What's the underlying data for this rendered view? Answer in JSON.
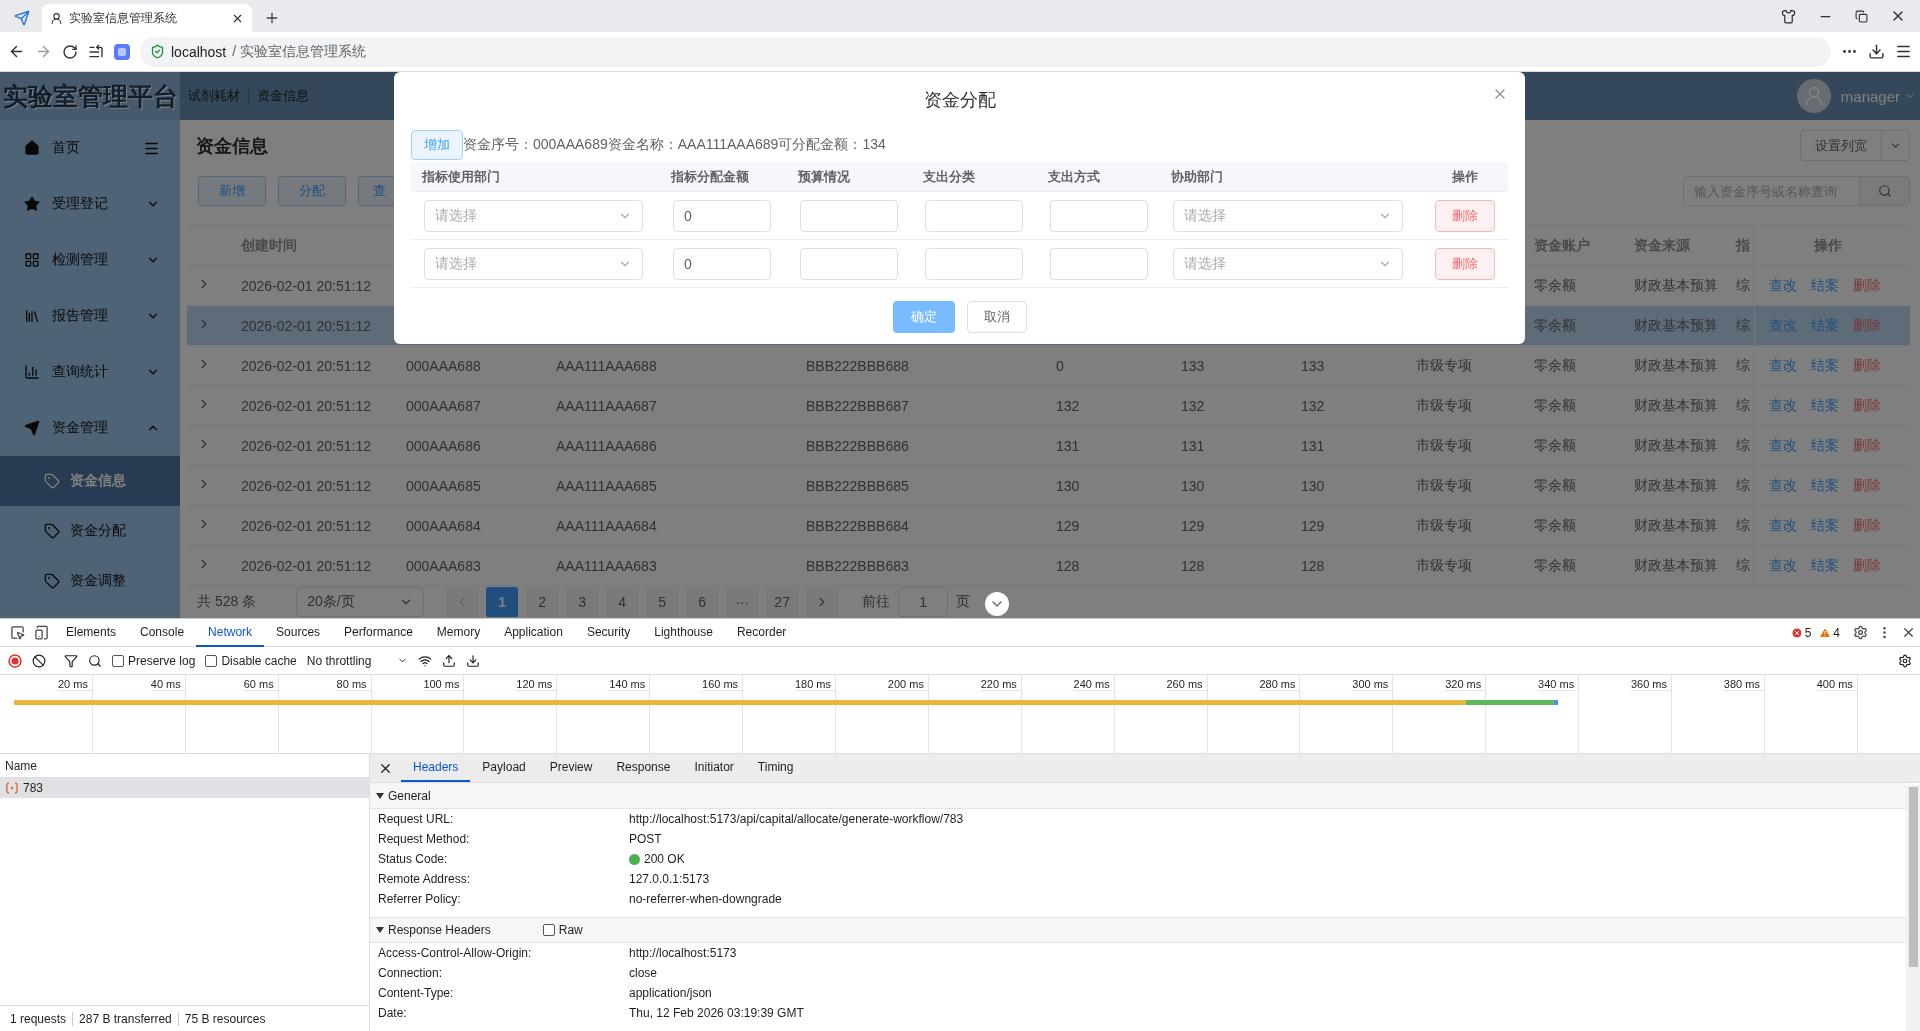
{
  "browser": {
    "tab_title": "实验室信息管理系统",
    "host": "localhost",
    "path": "/ 实验室信息管理系统"
  },
  "app": {
    "logo": "实验室管理平台",
    "breadcrumb": [
      "试剂耗材",
      "资金信息"
    ],
    "user": "manager"
  },
  "sidebar": {
    "items": [
      {
        "label": "首页"
      },
      {
        "label": "受理登记",
        "expanded": false
      },
      {
        "label": "检测管理",
        "expanded": false
      },
      {
        "label": "报告管理",
        "expanded": false
      },
      {
        "label": "查询统计",
        "expanded": false
      },
      {
        "label": "资金管理",
        "expanded": true,
        "children": [
          {
            "label": "资金信息",
            "selected": true
          },
          {
            "label": "资金分配",
            "selected": false
          },
          {
            "label": "资金调整",
            "selected": false
          }
        ]
      }
    ]
  },
  "page": {
    "title": "资金信息",
    "buttons": [
      "新增",
      "分配",
      "查"
    ],
    "settings_button": "设置列宽",
    "search": {
      "placeholder": "输入资金序号或名称查询"
    }
  },
  "table": {
    "header": {
      "created_at": "创建时间",
      "account": "资金账户",
      "source": "资金来源",
      "column_11": "指",
      "actions": "操作"
    },
    "rows": [
      {
        "selected": false,
        "created_at": "2026-02-01 20:51:12",
        "account": "零余额",
        "source": "财政基本预算",
        "column_11": "综",
        "actions": [
          "查改",
          "结案",
          "删除"
        ]
      },
      {
        "selected": true,
        "created_at": "2026-02-01 20:51:12",
        "account": "零余额",
        "source": "财政基本预算",
        "column_11": "综",
        "actions": [
          "查改",
          "结案",
          "删除"
        ]
      },
      {
        "selected": false,
        "created_at": "2026-02-01 20:51:12",
        "code": "000AAA688",
        "name": "AAA111AAA688",
        "budget_code": "BBB222BBB688",
        "column_5": "0",
        "column_6": "133",
        "column_7": "133",
        "category": "市级专项",
        "account": "零余额",
        "source": "财政基本预算",
        "column_11": "综",
        "actions": [
          "查改",
          "结案",
          "删除"
        ]
      },
      {
        "selected": false,
        "created_at": "2026-02-01 20:51:12",
        "code": "000AAA687",
        "name": "AAA111AAA687",
        "budget_code": "BBB222BBB687",
        "column_5": "132",
        "column_6": "132",
        "column_7": "132",
        "category": "市级专项",
        "account": "零余额",
        "source": "财政基本预算",
        "column_11": "综",
        "actions": [
          "查改",
          "结案",
          "删除"
        ]
      },
      {
        "selected": false,
        "created_at": "2026-02-01 20:51:12",
        "code": "000AAA686",
        "name": "AAA111AAA686",
        "budget_code": "BBB222BBB686",
        "column_5": "131",
        "column_6": "131",
        "column_7": "131",
        "category": "市级专项",
        "account": "零余额",
        "source": "财政基本预算",
        "column_11": "综",
        "actions": [
          "查改",
          "结案",
          "删除"
        ]
      },
      {
        "selected": false,
        "created_at": "2026-02-01 20:51:12",
        "code": "000AAA685",
        "name": "AAA111AAA685",
        "budget_code": "BBB222BBB685",
        "column_5": "130",
        "column_6": "130",
        "column_7": "130",
        "category": "市级专项",
        "account": "零余额",
        "source": "财政基本预算",
        "column_11": "综",
        "actions": [
          "查改",
          "结案",
          "删除"
        ]
      },
      {
        "selected": false,
        "created_at": "2026-02-01 20:51:12",
        "code": "000AAA684",
        "name": "AAA111AAA684",
        "budget_code": "BBB222BBB684",
        "column_5": "129",
        "column_6": "129",
        "column_7": "129",
        "category": "市级专项",
        "account": "零余额",
        "source": "财政基本预算",
        "column_11": "综",
        "actions": [
          "查改",
          "结案",
          "删除"
        ]
      },
      {
        "selected": false,
        "created_at": "2026-02-01 20:51:12",
        "code": "000AAA683",
        "name": "AAA111AAA683",
        "budget_code": "BBB222BBB683",
        "column_5": "128",
        "column_6": "128",
        "column_7": "128",
        "category": "市级专项",
        "account": "零余额",
        "source": "财政基本预算",
        "column_11": "综",
        "actions": [
          "查改",
          "结案",
          "删除"
        ]
      }
    ]
  },
  "pagination": {
    "total": "共 528 条",
    "page_size": "20条/页",
    "pages": [
      {
        "label": "1",
        "selected": true
      },
      {
        "label": "2",
        "selected": false
      },
      {
        "label": "3",
        "selected": false
      },
      {
        "label": "4",
        "selected": false
      },
      {
        "label": "5",
        "selected": false
      },
      {
        "label": "6",
        "selected": false
      },
      {
        "label": "···",
        "selected": false
      },
      {
        "label": "27",
        "selected": false
      }
    ],
    "goto_label": "前往",
    "goto_value": "1",
    "goto_unit": "页"
  },
  "dialog": {
    "title": "资金分配",
    "add_button": "增加",
    "info": "资金序号：000AAA689资金名称：AAA111AAA689可分配金额：134",
    "columns": [
      "指标使用部门",
      "指标分配金额",
      "预算情况",
      "支出分类",
      "支出方式",
      "协助部门",
      "操作"
    ],
    "rows": [
      {
        "department": {
          "placeholder": "请选择"
        },
        "amount": "0",
        "assist": {
          "placeholder": "请选择"
        },
        "delete_button": "删除"
      },
      {
        "department": {
          "placeholder": "请选择"
        },
        "amount": "0",
        "assist": {
          "placeholder": "请选择"
        },
        "delete_button": "删除"
      }
    ],
    "confirm_button": "确定",
    "cancel_button": "取消"
  },
  "devtools": {
    "tabs": [
      {
        "label": "Elements",
        "selected": false
      },
      {
        "label": "Console",
        "selected": false
      },
      {
        "label": "Network",
        "selected": true
      },
      {
        "label": "Sources",
        "selected": false
      },
      {
        "label": "Performance",
        "selected": false
      },
      {
        "label": "Memory",
        "selected": false
      },
      {
        "label": "Application",
        "selected": false
      },
      {
        "label": "Security",
        "selected": false
      },
      {
        "label": "Lighthouse",
        "selected": false
      },
      {
        "label": "Recorder",
        "selected": false
      }
    ],
    "errors": "5",
    "warnings": "4",
    "preserve_log": {
      "label": "Preserve log",
      "checked": false
    },
    "disable_cache": {
      "label": "Disable cache",
      "checked": false
    },
    "throttling": "No throttling",
    "ticks": [
      "20 ms",
      "40 ms",
      "60 ms",
      "80 ms",
      "100 ms",
      "120 ms",
      "140 ms",
      "160 ms",
      "180 ms",
      "200 ms",
      "220 ms",
      "240 ms",
      "260 ms",
      "280 ms",
      "300 ms",
      "320 ms",
      "340 ms",
      "360 ms",
      "380 ms",
      "400 ms"
    ],
    "requests": {
      "header": "Name",
      "rows": [
        {
          "name": "783",
          "selected": true
        }
      ],
      "summary": [
        "1 requests",
        "287 B transferred",
        "75 B resources"
      ]
    },
    "detail_tabs": [
      {
        "label": "Headers",
        "selected": true
      },
      {
        "label": "Payload",
        "selected": false
      },
      {
        "label": "Preview",
        "selected": false
      },
      {
        "label": "Response",
        "selected": false
      },
      {
        "label": "Initiator",
        "selected": false
      },
      {
        "label": "Timing",
        "selected": false
      }
    ],
    "sections": [
      {
        "title": "General",
        "expanded": true,
        "rows": [
          {
            "key": "Request URL:",
            "value": "http://localhost:5173/api/capital/allocate/generate-workflow/783"
          },
          {
            "key": "Request Method:",
            "value": "POST"
          },
          {
            "key": "Status Code:",
            "value": "200 OK",
            "color": "#4caf50"
          },
          {
            "key": "Remote Address:",
            "value": "127.0.0.1:5173"
          },
          {
            "key": "Referrer Policy:",
            "value": "no-referrer-when-downgrade"
          }
        ]
      },
      {
        "title": "Response Headers",
        "expanded": true,
        "raw": {
          "label": "Raw",
          "checked": false
        },
        "rows": [
          {
            "key": "Access-Control-Allow-Origin:",
            "value": "http://localhost:5173"
          },
          {
            "key": "Connection:",
            "value": "close"
          },
          {
            "key": "Content-Type:",
            "value": "application/json"
          },
          {
            "key": "Date:",
            "value": "Thu, 12 Feb 2026 03:19:39 GMT"
          }
        ]
      }
    ]
  }
}
